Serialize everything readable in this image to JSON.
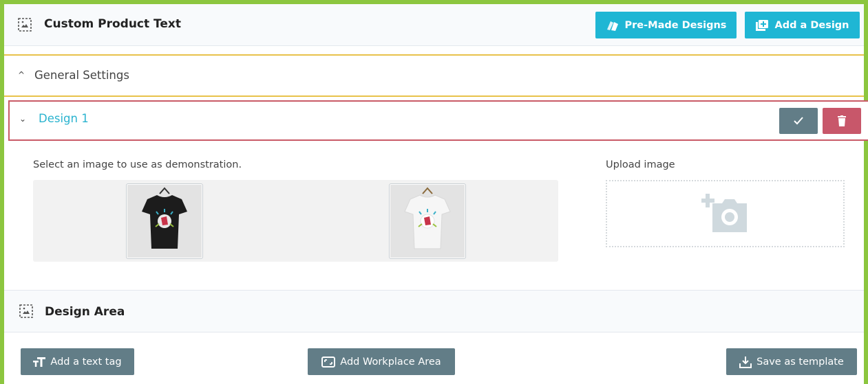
{
  "header": {
    "title": "Custom Product Text",
    "premade_label": "Pre-Made Designs",
    "add_design_label": "Add a Design"
  },
  "general": {
    "label": "General Settings"
  },
  "design": {
    "label": "Design 1",
    "select_label": "Select an image to use as demonstration.",
    "upload_label": "Upload image",
    "images": [
      {
        "shirt_color": "#1c1c1c",
        "selected": true
      },
      {
        "shirt_color": "#f4f4f4",
        "selected": false
      }
    ]
  },
  "design_area": {
    "title": "Design Area",
    "add_text_tag_label": "Add a text tag",
    "add_workplace_label": "Add Workplace Area",
    "save_template_label": "Save as template"
  },
  "colors": {
    "frame": "#8cc63f",
    "accent": "#1fb6d4",
    "general_border": "#e8c24a",
    "design_border": "#c95a66",
    "gray_button": "#627d87",
    "danger": "#c8576a"
  }
}
